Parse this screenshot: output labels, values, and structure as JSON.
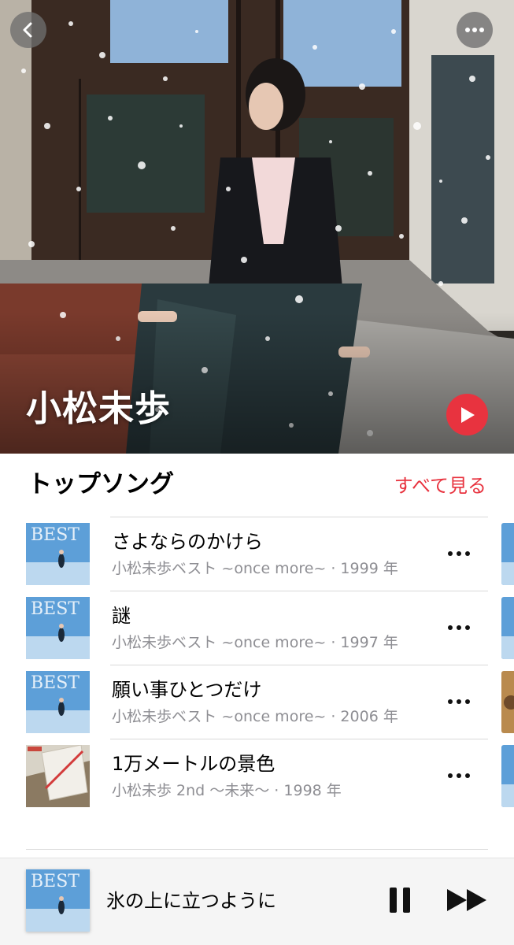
{
  "artist": {
    "name": "小松未歩"
  },
  "nav": {
    "back_icon": "chevron-left-icon",
    "more_icon": "ellipsis-icon",
    "play_icon": "play-icon"
  },
  "top_songs": {
    "title": "トップソング",
    "see_all": "すべて見る",
    "songs": [
      {
        "title": "さよならのかけら",
        "subtitle": "小松未歩ベスト ~once more~ · 1999 年",
        "art": "best-cover"
      },
      {
        "title": "謎",
        "subtitle": "小松未歩ベスト ~once more~ · 1997 年",
        "art": "best-cover"
      },
      {
        "title": "願い事ひとつだけ",
        "subtitle": "小松未歩ベスト ~once more~ · 2006 年",
        "art": "best-cover"
      },
      {
        "title": "1万メートルの景色",
        "subtitle": "小松未歩 2nd 〜未来〜 · 1998 年",
        "art": "mirai-cover"
      }
    ]
  },
  "mini_player": {
    "title": "氷の上に立つように",
    "state": "playing"
  },
  "colors": {
    "accent": "#e8333f",
    "secondary_text": "#8e8e93",
    "divider": "#d9d9d9"
  }
}
